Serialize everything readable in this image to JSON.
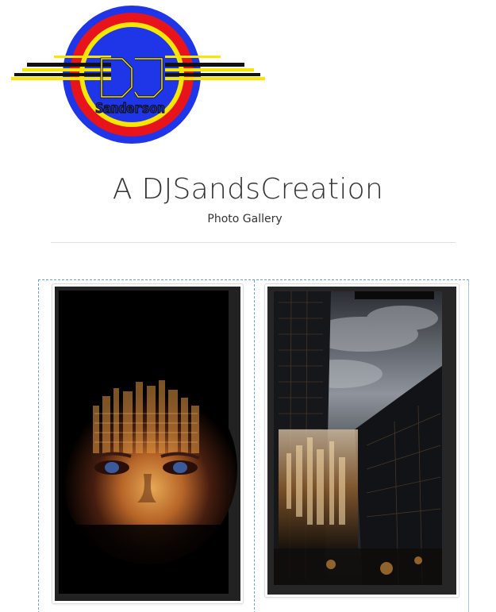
{
  "header": {
    "logo_icon": "dj-sanderson-logo",
    "logo_text": "DJ Sanderson",
    "title": "A DJSandsCreation",
    "subtitle": "Photo Gallery"
  },
  "gallery": {
    "photos": [
      {
        "icon": "city-face-photo"
      },
      {
        "icon": "skyscraper-city-photo"
      }
    ]
  },
  "colors": {
    "logo_blue": "#1f35e8",
    "logo_red": "#e8141c",
    "logo_yellow": "#f6e600",
    "gallery_border": "#6f9fc0",
    "divider": "#e1e1e1",
    "text": "#333333"
  }
}
